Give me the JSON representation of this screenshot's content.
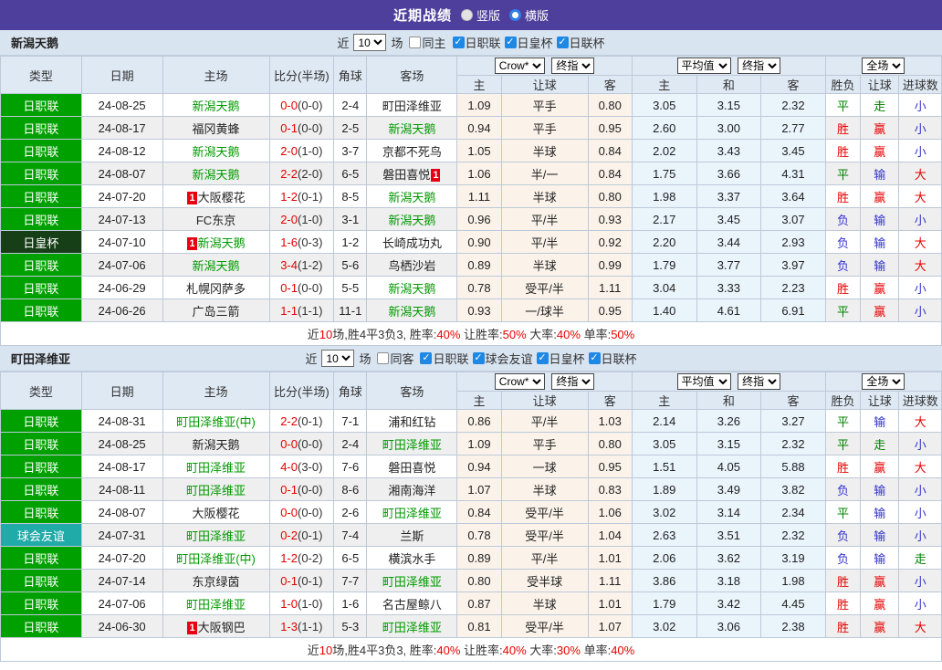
{
  "title_bar": {
    "title": "近期战绩",
    "vertical_label": "竖版",
    "vertical_checked": false,
    "horizontal_label": "横版",
    "horizontal_checked": true
  },
  "colors": {
    "accent_purple": "#4f3f9c",
    "league_green": "#00a000",
    "emperor_cup_dark_green": "#173f17",
    "friendly_teal": "#20aaa8",
    "team_green": "#009900",
    "win_red": "#e60000",
    "lose_blue": "#3333cc",
    "draw_green": "#008000",
    "score_red": "#e60000",
    "checkbox_blue": "#1e88e5"
  },
  "table_header": {
    "type": "类型",
    "date": "日期",
    "home": "主场",
    "score": "比分(半场)",
    "corner": "角球",
    "away": "客场",
    "odds_source": "Crow*",
    "final_index": "终指",
    "average": "平均值",
    "final_index2": "终指",
    "full_match": "全场",
    "sub_home": "主",
    "sub_handicap": "让球",
    "sub_away": "客",
    "sub_avg_home": "主",
    "sub_draw": "和",
    "sub_avg_away": "客",
    "sub_result": "胜负",
    "sub_result_handicap": "让球",
    "sub_goals": "进球数"
  },
  "sections": [
    {
      "team": "新潟天鹅",
      "filter": {
        "near_label": "近",
        "count": "10",
        "games_label": "场",
        "same_label": "同主",
        "same_checked": false,
        "leagues": [
          {
            "label": "日职联",
            "checked": true
          },
          {
            "label": "日皇杯",
            "checked": true
          },
          {
            "label": "日联杯",
            "checked": true
          }
        ]
      },
      "rows": [
        {
          "type": "日职联",
          "style": "league",
          "date": "24-08-25",
          "home": "新潟天鹅",
          "home_green": true,
          "score_ft": "0-0",
          "score_ht": "(0-0)",
          "corner": "2-4",
          "away": "町田泽维亚",
          "away_green": false,
          "crow": [
            "1.09",
            "平手",
            "0.80"
          ],
          "avg": [
            "3.05",
            "3.15",
            "2.32"
          ],
          "results": [
            [
              "平",
              "green"
            ],
            [
              "走",
              "green"
            ],
            [
              "小",
              "blue"
            ]
          ]
        },
        {
          "type": "日职联",
          "style": "league",
          "date": "24-08-17",
          "home": "福冈黄蜂",
          "home_green": false,
          "score_ft": "0-1",
          "score_ht": "(0-0)",
          "corner": "2-5",
          "away": "新潟天鹅",
          "away_green": true,
          "crow": [
            "0.94",
            "平手",
            "0.95"
          ],
          "avg": [
            "2.60",
            "3.00",
            "2.77"
          ],
          "results": [
            [
              "胜",
              "red"
            ],
            [
              "赢",
              "red"
            ],
            [
              "小",
              "blue"
            ]
          ]
        },
        {
          "type": "日职联",
          "style": "league",
          "date": "24-08-12",
          "home": "新潟天鹅",
          "home_green": true,
          "score_ft": "2-0",
          "score_ht": "(1-0)",
          "corner": "3-7",
          "away": "京都不死鸟",
          "away_green": false,
          "crow": [
            "1.05",
            "半球",
            "0.84"
          ],
          "avg": [
            "2.02",
            "3.43",
            "3.45"
          ],
          "results": [
            [
              "胜",
              "red"
            ],
            [
              "赢",
              "red"
            ],
            [
              "小",
              "blue"
            ]
          ]
        },
        {
          "type": "日职联",
          "style": "league",
          "date": "24-08-07",
          "home": "新潟天鹅",
          "home_green": true,
          "score_ft": "2-2",
          "score_ht": "(2-0)",
          "corner": "6-5",
          "away": "磐田喜悦",
          "away_green": false,
          "badge_away_after": "1",
          "crow": [
            "1.06",
            "半/一",
            "0.84"
          ],
          "avg": [
            "1.75",
            "3.66",
            "4.31"
          ],
          "results": [
            [
              "平",
              "green"
            ],
            [
              "输",
              "blue"
            ],
            [
              "大",
              "red"
            ]
          ]
        },
        {
          "type": "日职联",
          "style": "league",
          "date": "24-07-20",
          "home": "大阪樱花",
          "home_green": false,
          "badge_home_before": "1",
          "score_ft": "1-2",
          "score_ht": "(0-1)",
          "corner": "8-5",
          "away": "新潟天鹅",
          "away_green": true,
          "crow": [
            "1.11",
            "半球",
            "0.80"
          ],
          "avg": [
            "1.98",
            "3.37",
            "3.64"
          ],
          "results": [
            [
              "胜",
              "red"
            ],
            [
              "赢",
              "red"
            ],
            [
              "大",
              "red"
            ]
          ]
        },
        {
          "type": "日职联",
          "style": "league",
          "date": "24-07-13",
          "home": "FC东京",
          "home_green": false,
          "score_ft": "2-0",
          "score_ht": "(1-0)",
          "corner": "3-1",
          "away": "新潟天鹅",
          "away_green": true,
          "crow": [
            "0.96",
            "平/半",
            "0.93"
          ],
          "avg": [
            "2.17",
            "3.45",
            "3.07"
          ],
          "results": [
            [
              "负",
              "blue"
            ],
            [
              "输",
              "blue"
            ],
            [
              "小",
              "blue"
            ]
          ]
        },
        {
          "type": "日皇杯",
          "style": "emperor",
          "date": "24-07-10",
          "home": "新潟天鹅",
          "home_green": true,
          "badge_home_before": "1",
          "score_ft": "1-6",
          "score_ht": "(0-3)",
          "corner": "1-2",
          "away": "长崎成功丸",
          "away_green": false,
          "crow": [
            "0.90",
            "平/半",
            "0.92"
          ],
          "avg": [
            "2.20",
            "3.44",
            "2.93"
          ],
          "results": [
            [
              "负",
              "blue"
            ],
            [
              "输",
              "blue"
            ],
            [
              "大",
              "red"
            ]
          ]
        },
        {
          "type": "日职联",
          "style": "league",
          "date": "24-07-06",
          "home": "新潟天鹅",
          "home_green": true,
          "score_ft": "3-4",
          "score_ht": "(1-2)",
          "corner": "5-6",
          "away": "鸟栖沙岩",
          "away_green": false,
          "crow": [
            "0.89",
            "半球",
            "0.99"
          ],
          "avg": [
            "1.79",
            "3.77",
            "3.97"
          ],
          "results": [
            [
              "负",
              "blue"
            ],
            [
              "输",
              "blue"
            ],
            [
              "大",
              "red"
            ]
          ]
        },
        {
          "type": "日职联",
          "style": "league",
          "date": "24-06-29",
          "home": "札幌冈萨多",
          "home_green": false,
          "score_ft": "0-1",
          "score_ht": "(0-0)",
          "corner": "5-5",
          "away": "新潟天鹅",
          "away_green": true,
          "crow": [
            "0.78",
            "受平/半",
            "1.11"
          ],
          "avg": [
            "3.04",
            "3.33",
            "2.23"
          ],
          "results": [
            [
              "胜",
              "red"
            ],
            [
              "赢",
              "red"
            ],
            [
              "小",
              "blue"
            ]
          ]
        },
        {
          "type": "日职联",
          "style": "league",
          "date": "24-06-26",
          "home": "广岛三箭",
          "home_green": false,
          "score_ft": "1-1",
          "score_ht": "(1-1)",
          "corner": "11-1",
          "away": "新潟天鹅",
          "away_green": true,
          "crow": [
            "0.93",
            "一/球半",
            "0.95"
          ],
          "avg": [
            "1.40",
            "4.61",
            "6.91"
          ],
          "results": [
            [
              "平",
              "green"
            ],
            [
              "赢",
              "red"
            ],
            [
              "小",
              "blue"
            ]
          ]
        }
      ],
      "summary": [
        {
          "t": "近",
          "red": false
        },
        {
          "t": "10",
          "red": true
        },
        {
          "t": "场,胜4平3负3, 胜率:",
          "red": false
        },
        {
          "t": "40%",
          "red": true
        },
        {
          "t": " 让胜率:",
          "red": false
        },
        {
          "t": "50%",
          "red": true
        },
        {
          "t": " 大率:",
          "red": false
        },
        {
          "t": "40%",
          "red": true
        },
        {
          "t": " 单率:",
          "red": false
        },
        {
          "t": "50%",
          "red": true
        }
      ]
    },
    {
      "team": "町田泽维亚",
      "filter": {
        "near_label": "近",
        "count": "10",
        "games_label": "场",
        "same_label": "同客",
        "same_checked": false,
        "leagues": [
          {
            "label": "日职联",
            "checked": true
          },
          {
            "label": "球会友谊",
            "checked": true
          },
          {
            "label": "日皇杯",
            "checked": true
          },
          {
            "label": "日联杯",
            "checked": true
          }
        ]
      },
      "rows": [
        {
          "type": "日职联",
          "style": "league",
          "date": "24-08-31",
          "home": "町田泽维亚(中)",
          "home_green": true,
          "score_ft": "2-2",
          "score_ht": "(0-1)",
          "corner": "7-1",
          "away": "浦和红钻",
          "away_green": false,
          "crow": [
            "0.86",
            "平/半",
            "1.03"
          ],
          "avg": [
            "2.14",
            "3.26",
            "3.27"
          ],
          "results": [
            [
              "平",
              "green"
            ],
            [
              "输",
              "blue"
            ],
            [
              "大",
              "red"
            ]
          ]
        },
        {
          "type": "日职联",
          "style": "league",
          "date": "24-08-25",
          "home": "新潟天鹅",
          "home_green": false,
          "score_ft": "0-0",
          "score_ht": "(0-0)",
          "corner": "2-4",
          "away": "町田泽维亚",
          "away_green": true,
          "crow": [
            "1.09",
            "平手",
            "0.80"
          ],
          "avg": [
            "3.05",
            "3.15",
            "2.32"
          ],
          "results": [
            [
              "平",
              "green"
            ],
            [
              "走",
              "green"
            ],
            [
              "小",
              "blue"
            ]
          ]
        },
        {
          "type": "日职联",
          "style": "league",
          "date": "24-08-17",
          "home": "町田泽维亚",
          "home_green": true,
          "score_ft": "4-0",
          "score_ht": "(3-0)",
          "corner": "7-6",
          "away": "磐田喜悦",
          "away_green": false,
          "crow": [
            "0.94",
            "一球",
            "0.95"
          ],
          "avg": [
            "1.51",
            "4.05",
            "5.88"
          ],
          "results": [
            [
              "胜",
              "red"
            ],
            [
              "赢",
              "red"
            ],
            [
              "大",
              "red"
            ]
          ]
        },
        {
          "type": "日职联",
          "style": "league",
          "date": "24-08-11",
          "home": "町田泽维亚",
          "home_green": true,
          "score_ft": "0-1",
          "score_ht": "(0-0)",
          "corner": "8-6",
          "away": "湘南海洋",
          "away_green": false,
          "crow": [
            "1.07",
            "半球",
            "0.83"
          ],
          "avg": [
            "1.89",
            "3.49",
            "3.82"
          ],
          "results": [
            [
              "负",
              "blue"
            ],
            [
              "输",
              "blue"
            ],
            [
              "小",
              "blue"
            ]
          ]
        },
        {
          "type": "日职联",
          "style": "league",
          "date": "24-08-07",
          "home": "大阪樱花",
          "home_green": false,
          "score_ft": "0-0",
          "score_ht": "(0-0)",
          "corner": "2-6",
          "away": "町田泽维亚",
          "away_green": true,
          "crow": [
            "0.84",
            "受平/半",
            "1.06"
          ],
          "avg": [
            "3.02",
            "3.14",
            "2.34"
          ],
          "results": [
            [
              "平",
              "green"
            ],
            [
              "输",
              "blue"
            ],
            [
              "小",
              "blue"
            ]
          ]
        },
        {
          "type": "球会友谊",
          "style": "friendly",
          "date": "24-07-31",
          "home": "町田泽维亚",
          "home_green": true,
          "score_ft": "0-2",
          "score_ht": "(0-1)",
          "corner": "7-4",
          "away": "兰斯",
          "away_green": false,
          "crow": [
            "0.78",
            "受平/半",
            "1.04"
          ],
          "avg": [
            "2.63",
            "3.51",
            "2.32"
          ],
          "results": [
            [
              "负",
              "blue"
            ],
            [
              "输",
              "blue"
            ],
            [
              "小",
              "blue"
            ]
          ]
        },
        {
          "type": "日职联",
          "style": "league",
          "date": "24-07-20",
          "home": "町田泽维亚(中)",
          "home_green": true,
          "score_ft": "1-2",
          "score_ht": "(0-2)",
          "corner": "6-5",
          "away": "横滨水手",
          "away_green": false,
          "crow": [
            "0.89",
            "平/半",
            "1.01"
          ],
          "avg": [
            "2.06",
            "3.62",
            "3.19"
          ],
          "results": [
            [
              "负",
              "blue"
            ],
            [
              "输",
              "blue"
            ],
            [
              "走",
              "green"
            ]
          ]
        },
        {
          "type": "日职联",
          "style": "league",
          "date": "24-07-14",
          "home": "东京绿茵",
          "home_green": false,
          "score_ft": "0-1",
          "score_ht": "(0-1)",
          "corner": "7-7",
          "away": "町田泽维亚",
          "away_green": true,
          "crow": [
            "0.80",
            "受半球",
            "1.11"
          ],
          "avg": [
            "3.86",
            "3.18",
            "1.98"
          ],
          "results": [
            [
              "胜",
              "red"
            ],
            [
              "赢",
              "red"
            ],
            [
              "小",
              "blue"
            ]
          ]
        },
        {
          "type": "日职联",
          "style": "league",
          "date": "24-07-06",
          "home": "町田泽维亚",
          "home_green": true,
          "score_ft": "1-0",
          "score_ht": "(1-0)",
          "corner": "1-6",
          "away": "名古屋鲸八",
          "away_green": false,
          "crow": [
            "0.87",
            "半球",
            "1.01"
          ],
          "avg": [
            "1.79",
            "3.42",
            "4.45"
          ],
          "results": [
            [
              "胜",
              "red"
            ],
            [
              "赢",
              "red"
            ],
            [
              "小",
              "blue"
            ]
          ]
        },
        {
          "type": "日职联",
          "style": "league",
          "date": "24-06-30",
          "home": "大阪钢巴",
          "home_green": false,
          "badge_home_before": "1",
          "score_ft": "1-3",
          "score_ht": "(1-1)",
          "corner": "5-3",
          "away": "町田泽维亚",
          "away_green": true,
          "crow": [
            "0.81",
            "受平/半",
            "1.07"
          ],
          "avg": [
            "3.02",
            "3.06",
            "2.38"
          ],
          "results": [
            [
              "胜",
              "red"
            ],
            [
              "赢",
              "red"
            ],
            [
              "大",
              "red"
            ]
          ]
        }
      ],
      "summary": [
        {
          "t": "近",
          "red": false
        },
        {
          "t": "10",
          "red": true
        },
        {
          "t": "场,胜4平3负3, 胜率:",
          "red": false
        },
        {
          "t": "40%",
          "red": true
        },
        {
          "t": " 让胜率:",
          "red": false
        },
        {
          "t": "40%",
          "red": true
        },
        {
          "t": " 大率:",
          "red": false
        },
        {
          "t": "30%",
          "red": true
        },
        {
          "t": " 单率:",
          "red": false
        },
        {
          "t": "40%",
          "red": true
        }
      ]
    }
  ]
}
